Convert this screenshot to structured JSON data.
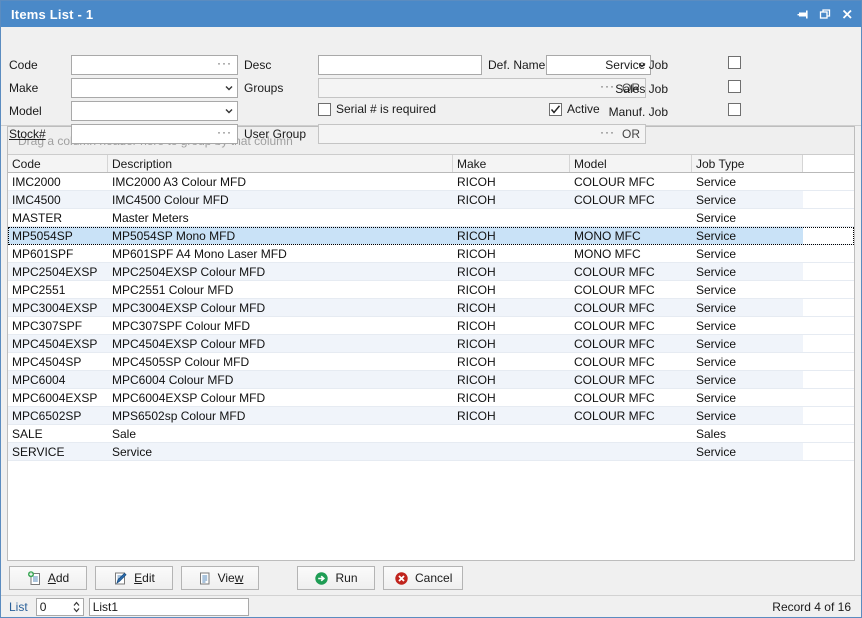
{
  "window": {
    "title": "Items List - 1",
    "title_bar_color": "#4a89c8",
    "controls": [
      {
        "name": "pin-icon",
        "label": "Pin"
      },
      {
        "name": "restore-icon",
        "label": "Restore"
      },
      {
        "name": "close-icon",
        "label": "Close"
      }
    ]
  },
  "filter": {
    "code": {
      "label": "Code",
      "value": "",
      "placeholder": "",
      "ellipsis": "···"
    },
    "make": {
      "label": "Make",
      "value": "",
      "placeholder": ""
    },
    "model": {
      "label": "Model",
      "value": "",
      "placeholder": ""
    },
    "stock": {
      "label": "Stock#",
      "value": "",
      "placeholder": "",
      "ellipsis": "···"
    },
    "desc": {
      "label": "Desc",
      "value": "",
      "placeholder": ""
    },
    "groups": {
      "label": "Groups",
      "value": "",
      "ellipsis": "···",
      "or": "OR"
    },
    "user_group": {
      "label": "User Group",
      "value": "",
      "ellipsis": "···",
      "or": "OR"
    },
    "def_name": {
      "label": "Def. Name",
      "value": ""
    },
    "serial_required": {
      "label": "Serial # is required",
      "checked": false
    },
    "active": {
      "label": "Active",
      "checked": true
    },
    "service_job": {
      "label": "Service Job",
      "checked": false
    },
    "sales_job": {
      "label": "Sales Job",
      "checked": false
    },
    "manuf_job": {
      "label": "Manuf. Job",
      "checked": false
    }
  },
  "grid": {
    "group_hint": "Drag a column header here to group by that column",
    "columns": [
      "Code",
      "Description",
      "Make",
      "Model",
      "Job Type"
    ],
    "selected_index": 3,
    "rows": [
      {
        "code": "IMC2000",
        "description": "IMC2000 A3 Colour MFD",
        "make": "RICOH",
        "model": "COLOUR MFC",
        "job_type": "Service"
      },
      {
        "code": "IMC4500",
        "description": "IMC4500  Colour MFD",
        "make": "RICOH",
        "model": "COLOUR MFC",
        "job_type": "Service"
      },
      {
        "code": "MASTER",
        "description": "Master Meters",
        "make": "",
        "model": "",
        "job_type": "Service"
      },
      {
        "code": "MP5054SP",
        "description": "MP5054SP Mono MFD",
        "make": "RICOH",
        "model": "MONO MFC",
        "job_type": "Service"
      },
      {
        "code": "MP601SPF",
        "description": "MP601SPF A4 Mono Laser MFD",
        "make": "RICOH",
        "model": "MONO MFC",
        "job_type": "Service"
      },
      {
        "code": "MPC2504EXSP",
        "description": "MPC2504EXSP Colour MFD",
        "make": "RICOH",
        "model": "COLOUR MFC",
        "job_type": "Service"
      },
      {
        "code": "MPC2551",
        "description": "MPC2551 Colour MFD",
        "make": "RICOH",
        "model": "COLOUR MFC",
        "job_type": "Service"
      },
      {
        "code": "MPC3004EXSP",
        "description": "MPC3004EXSP Colour MFD",
        "make": "RICOH",
        "model": "COLOUR MFC",
        "job_type": "Service"
      },
      {
        "code": "MPC307SPF",
        "description": "MPC307SPF Colour MFD",
        "make": "RICOH",
        "model": "COLOUR MFC",
        "job_type": "Service"
      },
      {
        "code": "MPC4504EXSP",
        "description": "MPC4504EXSP Colour MFD",
        "make": "RICOH",
        "model": "COLOUR MFC",
        "job_type": "Service"
      },
      {
        "code": "MPC4504SP",
        "description": "MPC4505SP Colour MFD",
        "make": "RICOH",
        "model": "COLOUR MFC",
        "job_type": "Service"
      },
      {
        "code": "MPC6004",
        "description": "MPC6004 Colour MFD",
        "make": "RICOH",
        "model": "COLOUR MFC",
        "job_type": "Service"
      },
      {
        "code": "MPC6004EXSP",
        "description": "MPC6004EXSP Colour MFD",
        "make": "RICOH",
        "model": "COLOUR MFC",
        "job_type": "Service"
      },
      {
        "code": "MPC6502SP",
        "description": "MPS6502sp Colour MFD",
        "make": "RICOH",
        "model": "COLOUR MFC",
        "job_type": "Service"
      },
      {
        "code": "SALE",
        "description": "Sale",
        "make": "",
        "model": "",
        "job_type": "Sales"
      },
      {
        "code": "SERVICE",
        "description": "Service",
        "make": "",
        "model": "",
        "job_type": "Service"
      }
    ]
  },
  "toolbar": {
    "add": {
      "label_pre": "",
      "label_mn": "A",
      "label_post": "dd"
    },
    "edit": {
      "label_pre": "",
      "label_mn": "E",
      "label_post": "dit"
    },
    "view": {
      "label_pre": "Vie",
      "label_mn": "w",
      "label_post": ""
    },
    "run": {
      "label": "Run"
    },
    "cancel": {
      "label": "Cancel"
    }
  },
  "status": {
    "list_label": "List",
    "list_index": "0",
    "list_name": "List1",
    "record_info": "Record 4 of 16"
  }
}
